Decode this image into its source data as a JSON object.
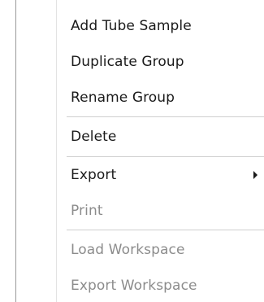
{
  "menu": {
    "items": [
      {
        "label": "Add Tube Sample",
        "enabled": true
      },
      {
        "label": "Duplicate Group",
        "enabled": true
      },
      {
        "label": "Rename Group",
        "enabled": true
      },
      {
        "label": "Delete",
        "enabled": true
      },
      {
        "label": "Export",
        "enabled": true,
        "has_submenu": true
      },
      {
        "label": "Print",
        "enabled": false
      },
      {
        "label": "Load Workspace",
        "enabled": false
      },
      {
        "label": "Export Workspace",
        "enabled": false
      }
    ],
    "submenu_icon": "triangle-right-icon"
  }
}
